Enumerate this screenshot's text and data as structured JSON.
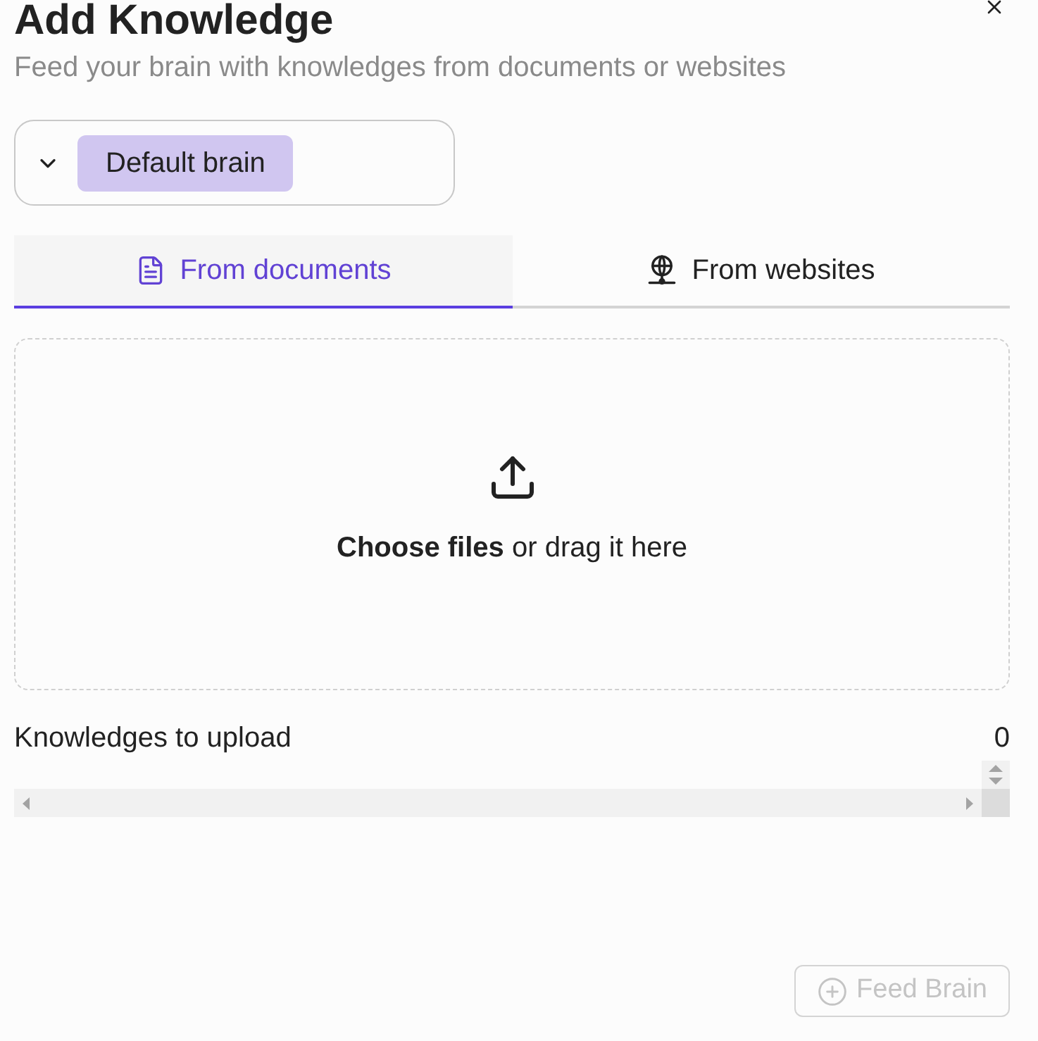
{
  "dialog": {
    "title": "Add Knowledge",
    "subtitle": "Feed your brain with knowledges from documents or websites"
  },
  "brain_select": {
    "value": "Default brain"
  },
  "tabs": [
    {
      "label": "From documents",
      "selected": true,
      "kind": "documents"
    },
    {
      "label": "From websites",
      "selected": false,
      "kind": "websites"
    }
  ],
  "dropzone": {
    "text": "**Choose files** or drag it here"
  },
  "upload_list": {
    "label": "Knowledges to upload",
    "count": "0"
  },
  "submit_button": {
    "label": "Feed Brain",
    "disabled": true
  }
}
